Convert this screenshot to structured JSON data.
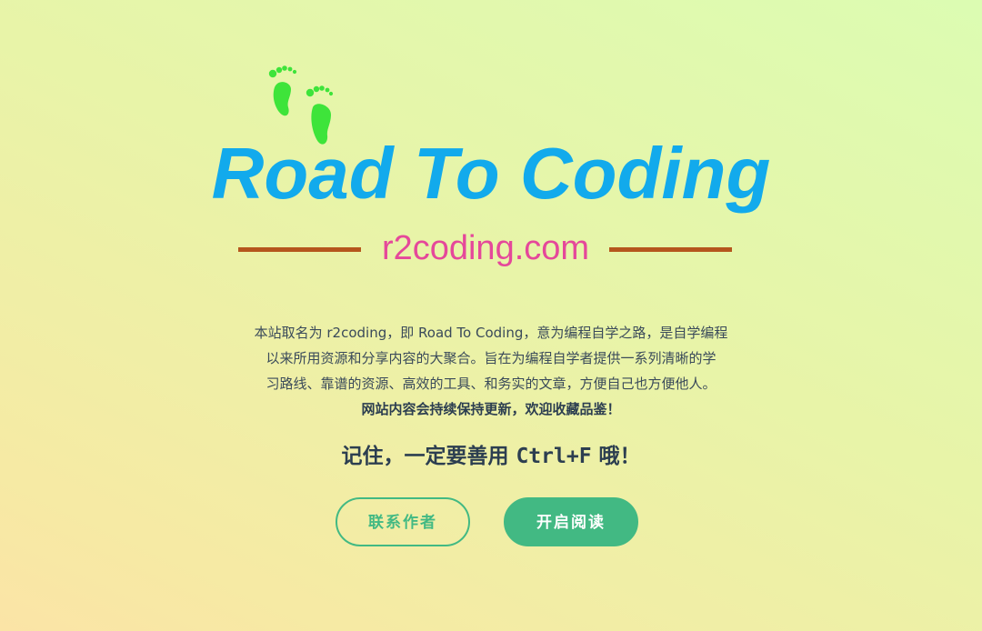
{
  "logo": {
    "title": "Road To Coding",
    "domain": "r2coding.com",
    "icon": "footprints-icon",
    "colors": {
      "title": "#12aaec",
      "domain": "#e5489a",
      "lines": "#b5561d",
      "footprints": "#3ee43a"
    }
  },
  "description": {
    "line1": "本站取名为 r2coding，即 Road To Coding，意为编程自学之路，是自学编程",
    "line2": "以来所用资源和分享内容的大聚合。旨在为编程自学者提供一系列清晰的学",
    "line3": "习路线、靠谱的资源、高效的工具、和务实的文章，方便自己也方便他人。",
    "line4": "网站内容会持续保持更新，欢迎收藏品鉴！"
  },
  "highlight": {
    "before": "记住，一定要善用 ",
    "code": "Ctrl+F",
    "after": " 哦！"
  },
  "buttons": {
    "contact": "联系作者",
    "start": "开启阅读"
  },
  "theme": {
    "accent": "#42b983",
    "text": "#2c3e50"
  }
}
